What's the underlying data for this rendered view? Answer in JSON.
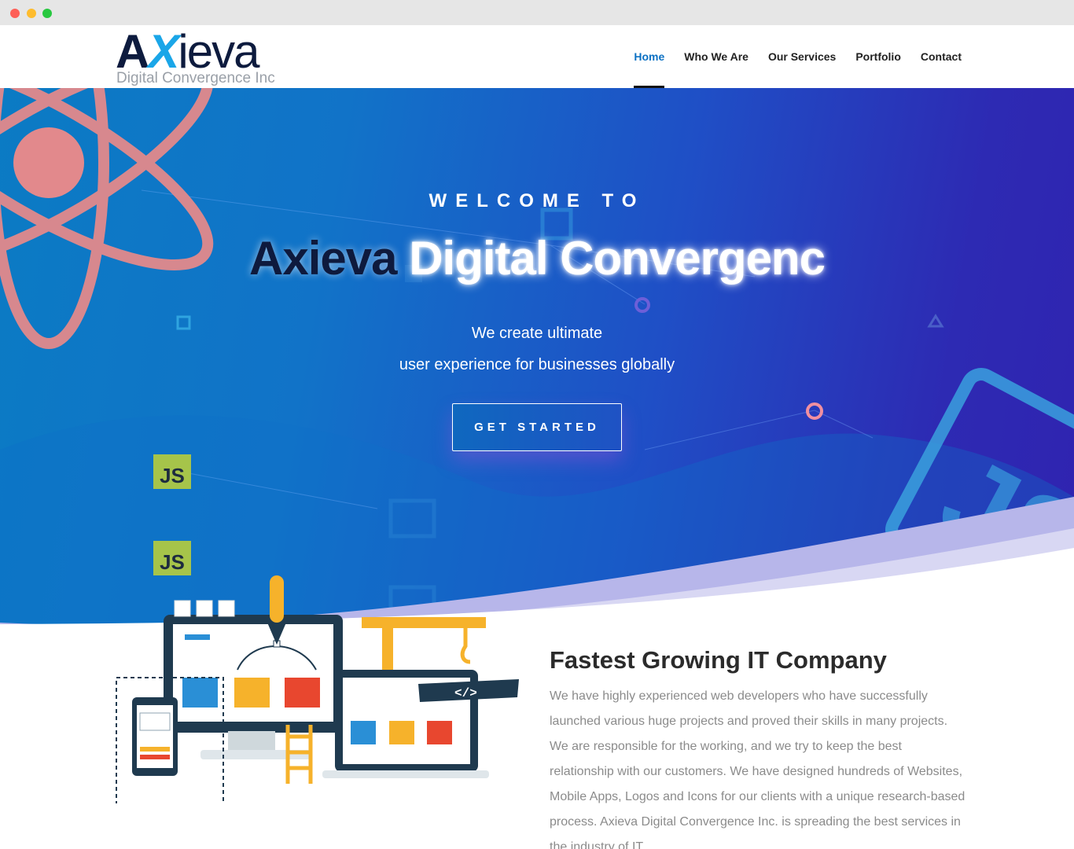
{
  "window": {
    "controls": [
      "close",
      "minimize",
      "maximize"
    ]
  },
  "logo": {
    "part_ax": "A",
    "part_x": "X",
    "part_ieva": "ieva",
    "tagline": "Digital Convergence Inc"
  },
  "nav": {
    "items": [
      {
        "label": "Home",
        "active": true
      },
      {
        "label": "Who We Are",
        "active": false
      },
      {
        "label": "Our Services",
        "active": false
      },
      {
        "label": "Portfolio",
        "active": false
      },
      {
        "label": "Contact",
        "active": false
      }
    ]
  },
  "hero": {
    "welcome": "WELCOME TO",
    "title_dark": "Axieva",
    "title_light": "Digital Convergenc",
    "subtitle_line1": "We create ultimate",
    "subtitle_line2": "user experience for businesses globally",
    "cta_label": "GET STARTED",
    "badge_js_1": "JS",
    "badge_js_2": "JS",
    "code_tag": "</>"
  },
  "about": {
    "title": "Fastest Growing IT Company",
    "text": "We have highly experienced web developers who have successfully launched various huge projects and proved their skills in many projects. We are responsible for the working, and we try to keep the best relationship with our customers. We have designed hundreds of Websites, Mobile Apps, Logos and Icons for our clients with a unique research-based process. Axieva Digital Convergence Inc. is spreading the best services in the industry of IT."
  },
  "colors": {
    "accent": "#0c71c3",
    "hero_start": "#0b7bc4",
    "hero_end": "#3023b0",
    "heading": "#2b2b2b",
    "body_text": "#8b8b8b"
  }
}
